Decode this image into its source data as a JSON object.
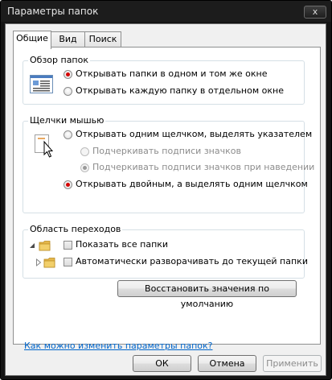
{
  "window": {
    "title": "Параметры папок",
    "close_label": "x"
  },
  "tabs": [
    {
      "label": "Общие"
    },
    {
      "label": "Вид"
    },
    {
      "label": "Поиск"
    }
  ],
  "browse_group": {
    "title": "Обзор папок",
    "options": [
      {
        "label": "Открывать папки в одном и том же окне",
        "checked": true
      },
      {
        "label": "Открывать каждую папку в отдельном окне",
        "checked": false
      }
    ]
  },
  "click_group": {
    "title": "Щелчки мышью",
    "options": [
      {
        "label": "Открывать одним щелчком, выделять указателем",
        "checked": false
      },
      {
        "label": "Подчеркивать подписи значков",
        "checked": false,
        "disabled": true
      },
      {
        "label": "Подчеркивать подписи значков при наведении",
        "checked": true,
        "disabled": true
      },
      {
        "label": "Открывать двойным, а выделять одним щелчком",
        "checked": true
      }
    ]
  },
  "nav_group": {
    "title": "Область переходов",
    "options": [
      {
        "label": "Показать все папки",
        "checked": false
      },
      {
        "label": "Автоматически разворачивать до текущей папки",
        "checked": false
      }
    ]
  },
  "restore_button": "Восстановить значения по умолчанию",
  "help_link": "Как можно изменить параметры папок?",
  "footer": {
    "ok": "ОК",
    "cancel": "Отмена",
    "apply": "Применить"
  }
}
